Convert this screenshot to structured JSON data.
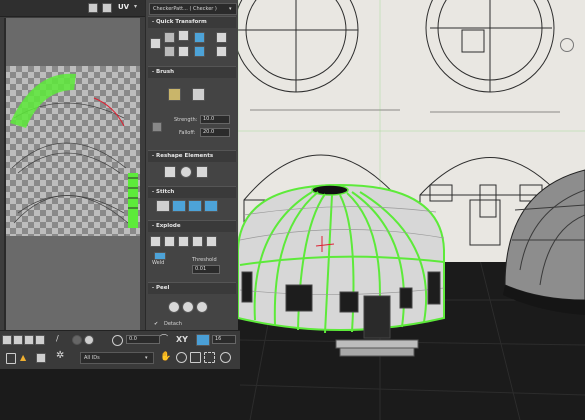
{
  "uv_editor": {
    "topbar": {
      "uv_label": "UV",
      "checker_dropdown": "CheckerPatt... ( Checker )"
    }
  },
  "panel": {
    "quick_transform": {
      "title": "Quick Transform",
      "toggle": "-"
    },
    "brush": {
      "title": "Brush",
      "toggle": "-",
      "strength_label": "Strength:",
      "strength_value": "10.0",
      "falloff_label": "Falloff:",
      "falloff_value": "20.0"
    },
    "reshape_elements": {
      "title": "Reshape Elements",
      "toggle": "-"
    },
    "stitch": {
      "title": "Stitch",
      "toggle": "-"
    },
    "explode": {
      "title": "Explode",
      "toggle": "-",
      "weld_label": "Weld",
      "threshold_label": "Threshold",
      "threshold_value": "0.01"
    },
    "peel": {
      "title": "Peel",
      "toggle": "-",
      "detach_label": "Detach",
      "detach_checked": true
    }
  },
  "bottombar": {
    "value1": "0.0",
    "axis_label": "XY",
    "value2": "16",
    "ids_dropdown": "All IDs"
  },
  "colors": {
    "panel_bg": "#444444",
    "uv_selection": "#5dea3a",
    "accent_blue": "#4da3d8"
  }
}
